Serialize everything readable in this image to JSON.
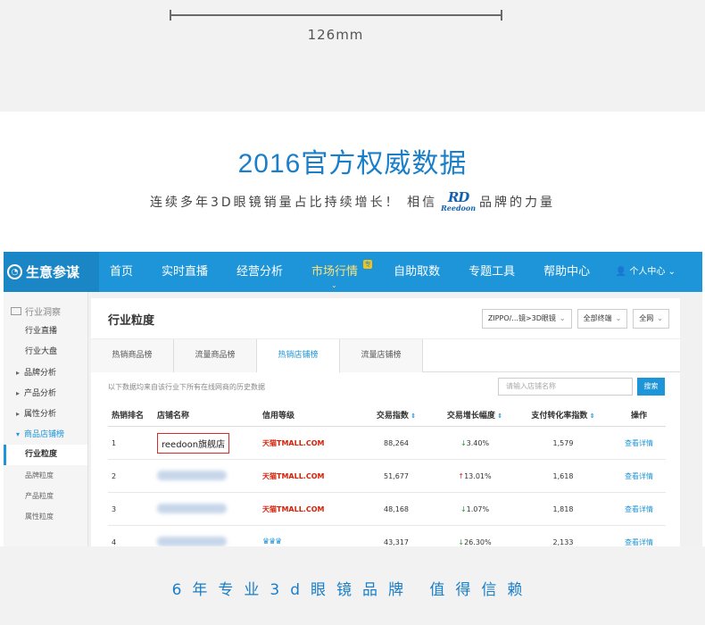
{
  "measurement": {
    "label": "126mm"
  },
  "headline": "2016官方权威数据",
  "subline": {
    "before": "连续多年3D眼镜销量占比持续增长！ 相信",
    "logo_mark": "RD",
    "logo_word": "Reedoon",
    "after": "品牌的力量"
  },
  "nav": {
    "brand": "生意参谋",
    "items": [
      {
        "label": "首页",
        "active": false
      },
      {
        "label": "实时直播",
        "active": false
      },
      {
        "label": "经营分析",
        "active": false
      },
      {
        "label": "市场行情",
        "active": true
      },
      {
        "label": "自助取数",
        "active": false
      },
      {
        "label": "专题工具",
        "active": false
      },
      {
        "label": "帮助中心",
        "active": false
      }
    ],
    "hot_badge": "专",
    "user_menu": "个人中心"
  },
  "sidebar": {
    "section": "行业洞察",
    "items": [
      {
        "label": "行业直播",
        "type": "item"
      },
      {
        "label": "行业大盘",
        "type": "item"
      },
      {
        "label": "品牌分析",
        "type": "group"
      },
      {
        "label": "产品分析",
        "type": "group"
      },
      {
        "label": "属性分析",
        "type": "group"
      },
      {
        "label": "商品店铺榜",
        "type": "group-open"
      },
      {
        "label": "行业粒度",
        "type": "current"
      },
      {
        "label": "品牌粒度",
        "type": "sub"
      },
      {
        "label": "产品粒度",
        "type": "sub"
      },
      {
        "label": "属性粒度",
        "type": "sub"
      }
    ]
  },
  "panel": {
    "title": "行业粒度",
    "filters": [
      "ZIPPO/...镜>3D眼镜",
      "全部终端",
      "全网"
    ],
    "tabs": [
      "热销商品榜",
      "流量商品榜",
      "热销店铺榜",
      "流量店铺榜"
    ],
    "active_tab": 2,
    "note": "以下数据均来自该行业下所有在线网商的历史数据",
    "search_placeholder": "请输入店铺名称",
    "search_button": "搜索"
  },
  "table": {
    "headers": [
      "热销排名",
      "店铺名称",
      "信用等级",
      "交易指数",
      "交易增长幅度",
      "支付转化率指数",
      "操作"
    ],
    "rows": [
      {
        "rank": "1",
        "store": "reedoon旗舰店",
        "store_visible": true,
        "credit": "天猫TMALL.COM",
        "credit_type": "tmall",
        "index": "88,264",
        "growth_arrow": "↓",
        "growth_dir": "down",
        "growth": "3.40%",
        "conversion": "1,579",
        "action": "查看详情"
      },
      {
        "rank": "2",
        "store": "",
        "store_visible": false,
        "credit": "天猫TMALL.COM",
        "credit_type": "tmall",
        "index": "51,677",
        "growth_arrow": "↑",
        "growth_dir": "up",
        "growth": "13.01%",
        "conversion": "1,618",
        "action": "查看详情"
      },
      {
        "rank": "3",
        "store": "",
        "store_visible": false,
        "credit": "天猫TMALL.COM",
        "credit_type": "tmall",
        "index": "48,168",
        "growth_arrow": "↓",
        "growth_dir": "down",
        "growth": "1.07%",
        "conversion": "1,818",
        "action": "查看详情"
      },
      {
        "rank": "4",
        "store": "",
        "store_visible": false,
        "credit": "♛♛♛",
        "credit_type": "crowns",
        "index": "43,317",
        "growth_arrow": "↓",
        "growth_dir": "down",
        "growth": "26.30%",
        "conversion": "2,133",
        "action": "查看详情"
      }
    ]
  },
  "slogan": "6年专业3d眼镜品牌 值得信赖",
  "colors": {
    "brand_blue": "#1d95d8",
    "headline_blue": "#1a7fc8",
    "highlight_red": "#d62b2b",
    "growth_down": "#2c9b3a",
    "growth_up": "#d9272e"
  }
}
